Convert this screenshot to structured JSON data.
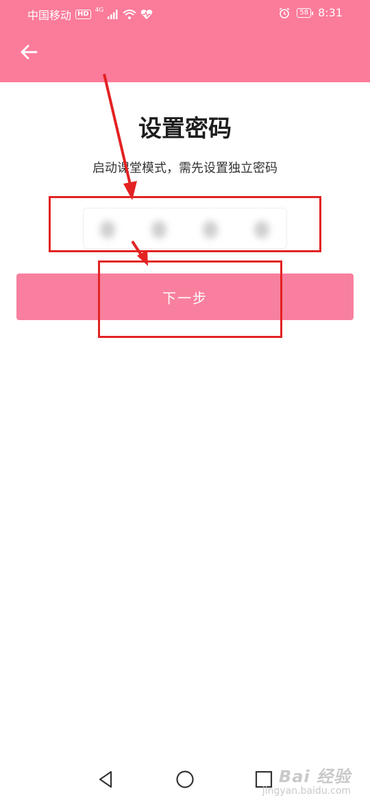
{
  "status_bar": {
    "carrier": "中国移动",
    "hd_badge": "HD",
    "network": "4G",
    "battery": "58",
    "time": "8:31"
  },
  "header": {
    "back_icon": "arrow-left-icon",
    "background_color": "#fb7b9a"
  },
  "main": {
    "title": "设置密码",
    "subtitle": "启动课堂模式，需先设置独立密码",
    "pin_length": 4,
    "next_button_label": "下一步",
    "button_color": "#f8809e"
  },
  "annotation": {
    "color": "#e32222"
  },
  "nav_bar": {
    "back_icon": "triangle-back-icon",
    "home_icon": "circle-home-icon",
    "recents_icon": "square-recents-icon"
  },
  "watermark": {
    "text": "Bai 经验",
    "url": "jingyan.baidu.com"
  }
}
